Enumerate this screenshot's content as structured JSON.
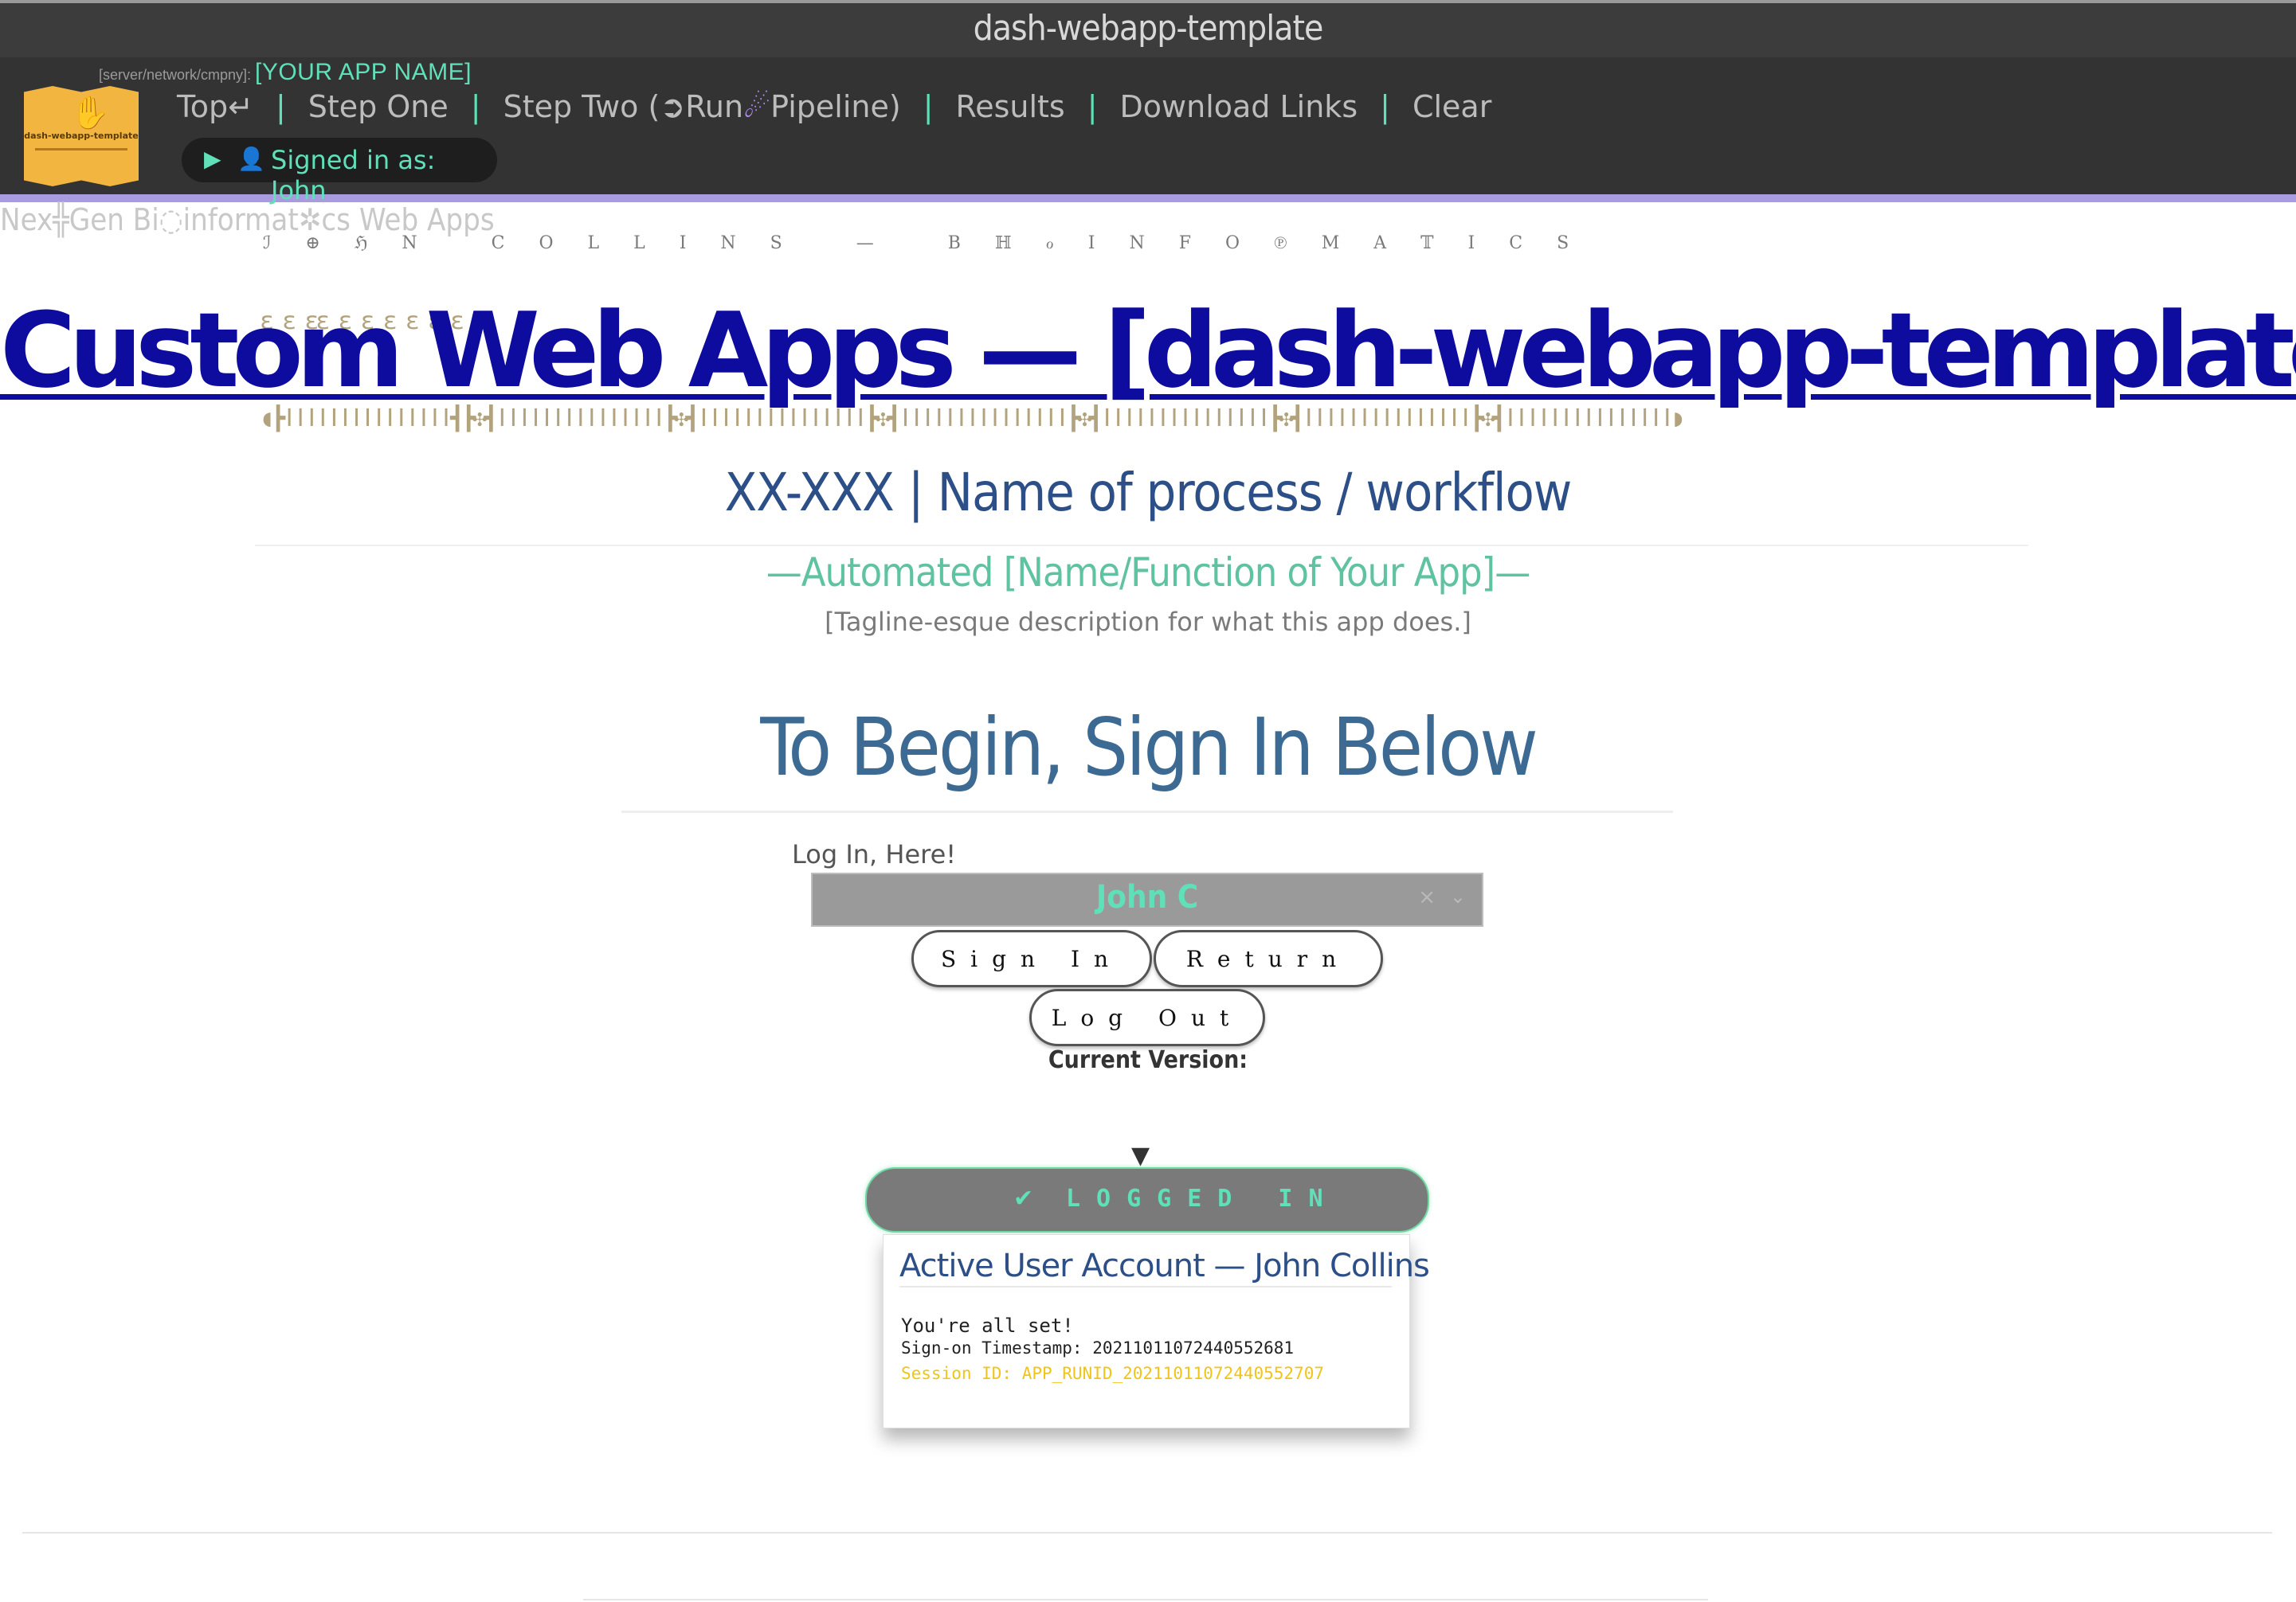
{
  "window": {
    "title": "dash-webapp-template"
  },
  "navbar": {
    "logo_text": "dash-webapp-template",
    "server_label": "[server/network/cmpny]:",
    "app_name": "[YOUR APP NAME]",
    "links": {
      "top": "Top↵",
      "step_one": "Step One",
      "step_two_prefix": "Step Two (",
      "step_two_glyph1": "➲",
      "step_two_run": "Run",
      "step_two_glyph2": "☄",
      "step_two_suffix": "Pipeline)",
      "results": "Results",
      "downloads": "Download Links",
      "clear": "Clear",
      "separator": "|"
    },
    "signed_in": {
      "play_glyph": "▶",
      "user_glyph": "👤",
      "text": "Signed in as: John"
    }
  },
  "header": {
    "watermark": "Nex╬Gen Bi◌informat✲cs Web Apps",
    "spaced_subtitle": "ℐ⊕ℌN COLLINS — BℍℴINFO℗MA𝕋ICS",
    "ornament_top": "ɛ ɛ ɛɛ ɛ ɛ ɛ ɛ ɛ ɛ",
    "ornament_bottom": "◖┣ǀǀǀǀǀǀǀǀǀǀǀǀǀǀǀ┫┣✣┫ǀǀǀǀǀǀǀǀǀǀǀǀǀǀǀ┣✣┫ǀǀǀǀǀǀǀǀǀǀǀǀǀǀǀ┣✣┫ǀǀǀǀǀǀǀǀǀǀǀǀǀǀǀ┣✣┫ǀǀǀǀǀǀǀǀǀǀǀǀǀǀǀ┣✣┫ǀǀǀǀǀǀǀǀǀǀǀǀǀǀǀ┣✣┫ǀǀǀǀǀǀǀǀǀǀǀǀǀǀǀ◗",
    "main_title": "Custom Web Apps — [dash-webapp-template]",
    "process_title": "XX-XXX | Name of process / workflow",
    "automated": "—Automated [Name/Function of Your App]—",
    "tagline": "[Tagline-esque description for what this app does.]"
  },
  "signin": {
    "heading": "To Begin, Sign In Below",
    "login_label": "Log In, Here!",
    "selected_user": "John C",
    "clear_glyph": "×",
    "dropdown_glyph": "⌄",
    "sign_in_button": "Sign In",
    "return_button": "Return",
    "logout_button": "Log Out",
    "version_label": "Current Version:",
    "caret_glyph": "▼"
  },
  "status": {
    "check_glyph": "✔",
    "logged_in_text": "LOGGED IN",
    "account_title": "Active User Account — John Collins",
    "all_set": "You're all set!",
    "timestamp": "Sign-on Timestamp: 20211011072440552681",
    "session_id": "Session ID: APP_RUNID_20211011072440552707"
  },
  "colors": {
    "nav_bg": "#333333",
    "accent_green": "#5fe0b8",
    "accent_purple": "#a99be0",
    "title_blue": "#0e0c9e",
    "session_yellow": "#f0c419"
  }
}
